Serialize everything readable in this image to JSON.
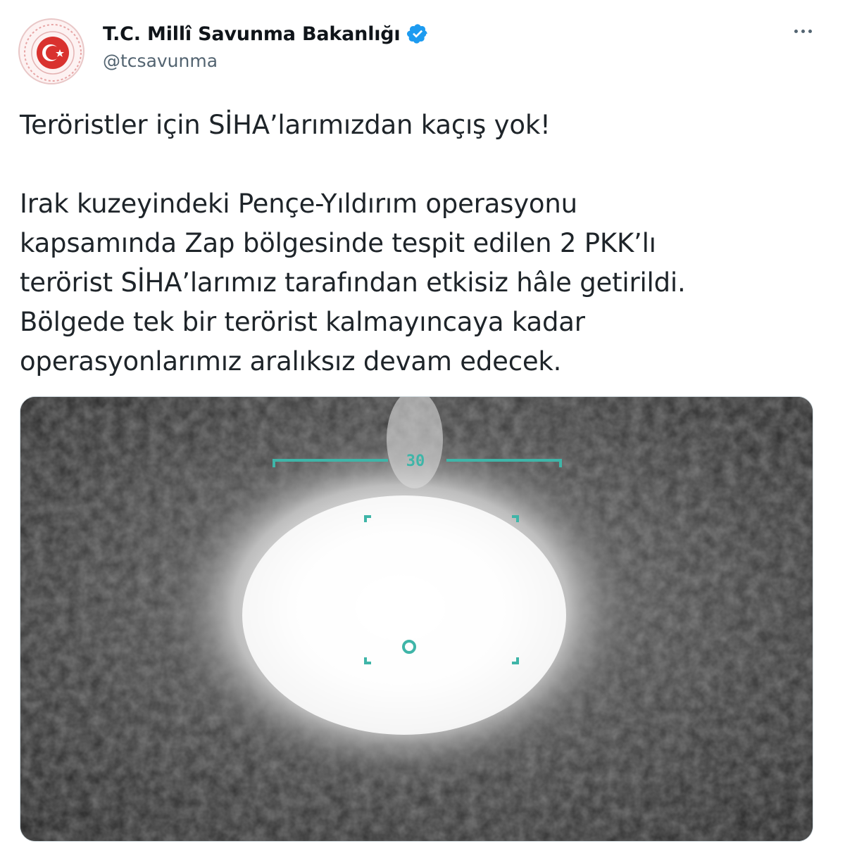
{
  "account": {
    "display_name": "T.C. Millî Savunma Bakanlığı",
    "handle": "@tcsavunma",
    "verified": true
  },
  "icons": {
    "avatar": "turkish-crescent-star-emblem",
    "verified": "verified-badge-icon",
    "more": "more-options-icon"
  },
  "colors": {
    "verified_badge": "#1d9bf0",
    "emblem_red": "#d9322f",
    "hud_teal": "#3fb5a8"
  },
  "tweet": {
    "headline": "Teröristler için SİHA’larımızdan kaçış yok!",
    "lines": [
      "Irak kuzeyindeki Pençe-Yıldırım operasyonu",
      "kapsamında Zap bölgesinde tespit edilen 2 PKK’lı",
      "terörist SİHA’larımız tarafından etkisiz hâle getirildi.",
      "Bölgede tek bir terörist kalmayıncaya kadar",
      "operasyonlarımız aralıksız devam edecek."
    ]
  },
  "media": {
    "hud_readout": "30"
  }
}
